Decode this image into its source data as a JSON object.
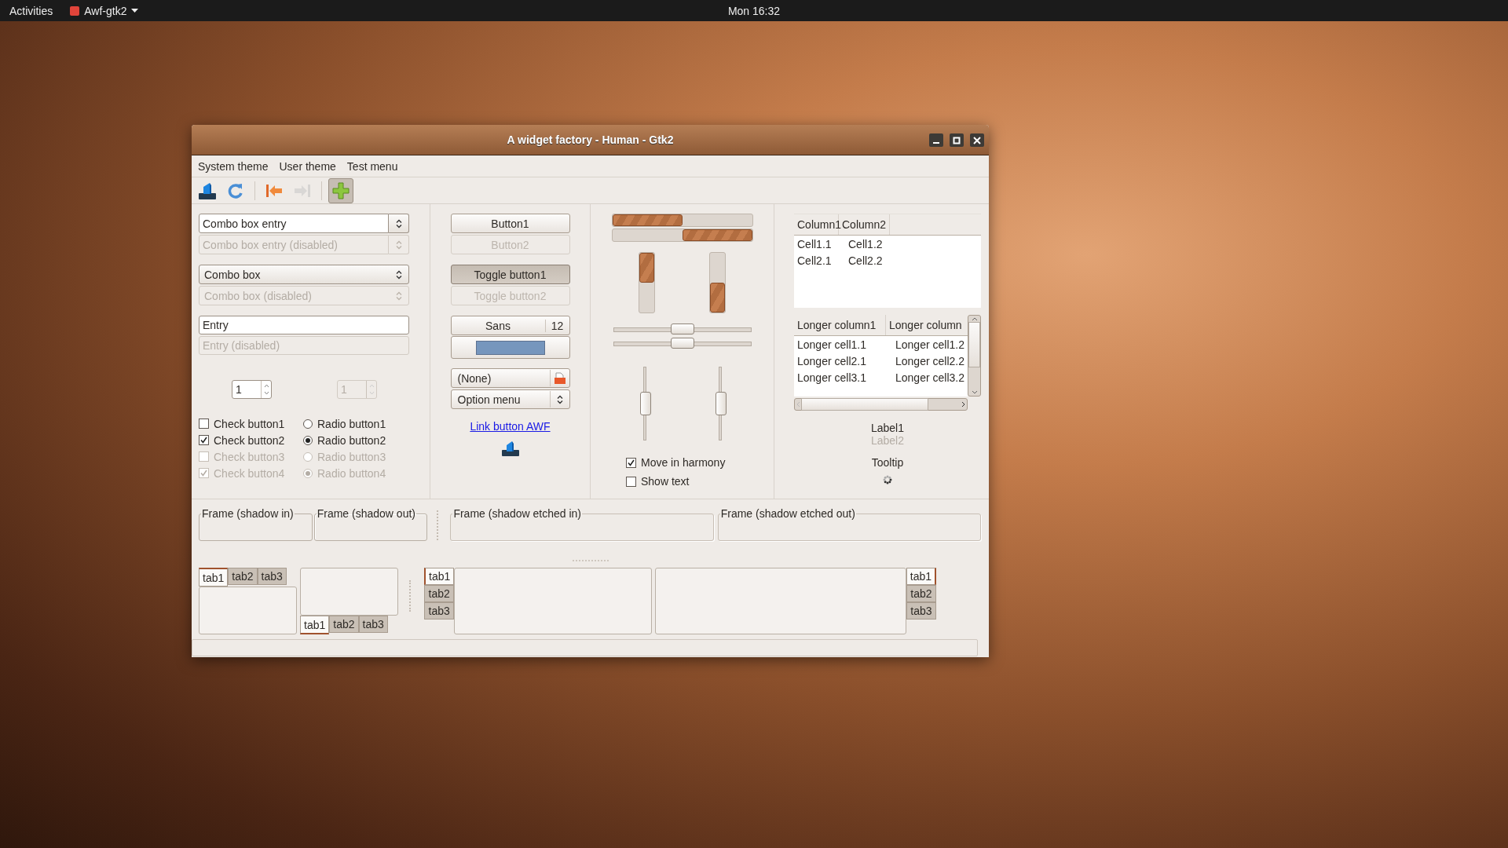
{
  "topbar": {
    "activities": "Activities",
    "app": "Awf-gtk2",
    "clock": "Mon 16:32"
  },
  "window": {
    "title": "A widget factory - Human - Gtk2"
  },
  "menu": [
    {
      "label": "System theme"
    },
    {
      "label": "User theme"
    },
    {
      "label": "Test menu"
    }
  ],
  "toolbar": [
    {
      "kind": "drive",
      "disabled": false,
      "on": false
    },
    {
      "kind": "refresh",
      "disabled": false,
      "on": false
    },
    {
      "kind": "separator"
    },
    {
      "kind": "back",
      "disabled": false,
      "on": false
    },
    {
      "kind": "forward",
      "disabled": true,
      "on": false
    },
    {
      "kind": "separator"
    },
    {
      "kind": "add",
      "disabled": false,
      "on": true
    }
  ],
  "combos": [
    {
      "kind": "entry",
      "value": "Combo box entry",
      "disabled": false
    },
    {
      "kind": "entry",
      "value": "Combo box entry (disabled)",
      "disabled": true
    },
    {
      "kind": "combo",
      "value": "Combo box",
      "disabled": false
    },
    {
      "kind": "combo",
      "value": "Combo box (disabled)",
      "disabled": true
    }
  ],
  "entries": [
    {
      "value": "Entry",
      "disabled": false
    },
    {
      "value": "Entry (disabled)",
      "disabled": true
    }
  ],
  "spins": [
    {
      "value": "1",
      "disabled": false
    },
    {
      "value": "1",
      "disabled": true
    }
  ],
  "checks": [
    {
      "label": "Check button1",
      "checked": false,
      "disabled": false
    },
    {
      "label": "Check button2",
      "checked": true,
      "disabled": false
    },
    {
      "label": "Check button3",
      "checked": false,
      "disabled": true
    },
    {
      "label": "Check button4",
      "checked": true,
      "disabled": true
    }
  ],
  "radios": [
    {
      "label": "Radio button1",
      "selected": false,
      "disabled": false
    },
    {
      "label": "Radio button2",
      "selected": true,
      "disabled": false
    },
    {
      "label": "Radio button3",
      "selected": false,
      "disabled": true
    },
    {
      "label": "Radio button4",
      "selected": true,
      "disabled": true
    }
  ],
  "buttons": [
    {
      "label": "Button1",
      "on": false,
      "disabled": false
    },
    {
      "label": "Button2",
      "on": false,
      "disabled": true
    },
    {
      "label": "Toggle button1",
      "on": true,
      "disabled": false
    },
    {
      "label": "Toggle button2",
      "on": false,
      "disabled": true
    }
  ],
  "font_button": {
    "family": "Sans",
    "size": "12"
  },
  "color_button": {
    "color": "#7696bd"
  },
  "file_chooser": {
    "value": "(None)"
  },
  "option_menu": {
    "value": "Option menu"
  },
  "link": {
    "label": "Link button AWF"
  },
  "progress_h": [
    {
      "level": 0.5,
      "inverted": false
    },
    {
      "level": 0.5,
      "inverted": true
    }
  ],
  "progress_v": [
    {
      "level": 0.5,
      "inverted": false
    },
    {
      "level": 0.5,
      "inverted": true
    }
  ],
  "scales_h": [
    {
      "level": 0.5
    },
    {
      "level": 0.5
    }
  ],
  "scales_v": [
    {
      "level": 0.5
    },
    {
      "level": 0.5
    }
  ],
  "options": [
    {
      "label": "Move in harmony",
      "checked": true
    },
    {
      "label": "Show text",
      "checked": false
    }
  ],
  "tree1": {
    "columns": [
      "Column1",
      "Column2"
    ],
    "rows": [
      [
        "Cell1.1",
        "Cell1.2"
      ],
      [
        "Cell2.1",
        "Cell2.2"
      ]
    ]
  },
  "tree2": {
    "columns": [
      "Longer column1",
      "Longer column"
    ],
    "rows": [
      [
        "Longer cell1.1",
        "Longer cell1.2"
      ],
      [
        "Longer cell2.1",
        "Longer cell2.2"
      ],
      [
        "Longer cell3.1",
        "Longer cell3.2"
      ]
    ]
  },
  "labels": [
    {
      "text": "Label1",
      "disabled": false
    },
    {
      "text": "Label2",
      "disabled": true
    }
  ],
  "tooltip": "Tooltip",
  "frames": [
    {
      "label": "Frame (shadow in)",
      "kind": "in"
    },
    {
      "label": "Frame (shadow out)",
      "kind": "out"
    },
    {
      "label": "Frame (shadow etched in)",
      "kind": "etched"
    },
    {
      "label": "Frame (shadow etched out)",
      "kind": "etched"
    }
  ],
  "notebooks": [
    {
      "kind": "top",
      "tabs": [
        {
          "label": "tab1",
          "selected": true
        },
        {
          "label": "tab2",
          "selected": false
        },
        {
          "label": "tab3",
          "selected": false
        }
      ]
    },
    {
      "kind": "bottom",
      "tabs": [
        {
          "label": "tab1",
          "selected": true
        },
        {
          "label": "tab2",
          "selected": false
        },
        {
          "label": "tab3",
          "selected": false
        }
      ]
    },
    {
      "kind": "left",
      "tabs": [
        {
          "label": "tab1",
          "selected": true
        },
        {
          "label": "tab2",
          "selected": false
        },
        {
          "label": "tab3",
          "selected": false
        }
      ]
    },
    {
      "kind": "right",
      "tabs": [
        {
          "label": "tab1",
          "selected": true
        },
        {
          "label": "tab2",
          "selected": false
        },
        {
          "label": "tab3",
          "selected": false
        }
      ]
    }
  ]
}
